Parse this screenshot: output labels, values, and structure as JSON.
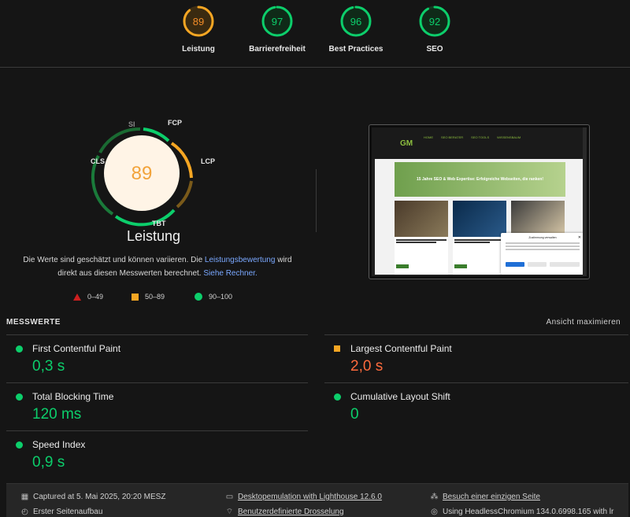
{
  "top_scores": [
    {
      "label": "Leistung",
      "score": "89",
      "value": 89,
      "color": "#f5a623",
      "text_color": "#f28c28"
    },
    {
      "label": "Barrierefreiheit",
      "score": "97",
      "value": 97,
      "color": "#0cce6b",
      "text_color": "#0cce6b"
    },
    {
      "label": "Best Practices",
      "score": "96",
      "value": 96,
      "color": "#0cce6b",
      "text_color": "#0cce6b"
    },
    {
      "label": "SEO",
      "score": "92",
      "value": 92,
      "color": "#0cce6b",
      "text_color": "#0cce6b"
    }
  ],
  "main_gauge": {
    "score": "89",
    "value": 89,
    "title": "Leistung",
    "metric_labels": {
      "si": "SI",
      "fcp": "FCP",
      "lcp": "LCP",
      "cls": "CLS",
      "tbt": "TBT"
    }
  },
  "note": {
    "text1": "Die Werte sind geschätzt und können variieren. Die ",
    "link1": "Leistungsbewertung",
    "text2": " wird direkt aus diesen Messwerten berechnet. ",
    "link2": "Siehe Rechner."
  },
  "legend": {
    "fail": "0–49",
    "average": "50–89",
    "pass": "90–100"
  },
  "screenshot": {
    "logo": "GM",
    "menu": [
      "HOME",
      "SEO BERATER",
      "SEO TOOLS",
      "WISSENSBAUM"
    ],
    "hero": "15 Jahre SEO & Web Expertise: Erfolgreiche Webseiten, die ranken!",
    "cookie_title": "Zustimmung verwalten"
  },
  "metrics_section": {
    "title": "MESSWERTE",
    "expand": "Ansicht maximieren"
  },
  "metrics": [
    {
      "name": "First Contentful Paint",
      "value": "0,3 s",
      "rating": "pass"
    },
    {
      "name": "Largest Contentful Paint",
      "value": "2,0 s",
      "rating": "average"
    },
    {
      "name": "Total Blocking Time",
      "value": "120 ms",
      "rating": "pass"
    },
    {
      "name": "Cumulative Layout Shift",
      "value": "0",
      "rating": "pass"
    },
    {
      "name": "Speed Index",
      "value": "0,9 s",
      "rating": "pass"
    }
  ],
  "footer": {
    "captured": "Captured at 5. Mai 2025, 20:20 MESZ",
    "emulation": "Desktopemulation with Lighthouse 12.6.0",
    "single_page": "Besuch einer einzigen Seite",
    "first_load": "Erster Seitenaufbau",
    "throttling": "Benutzerdefinierte Drosselung",
    "browser": "Using HeadlessChromium 134.0.6998.165 with lr"
  }
}
